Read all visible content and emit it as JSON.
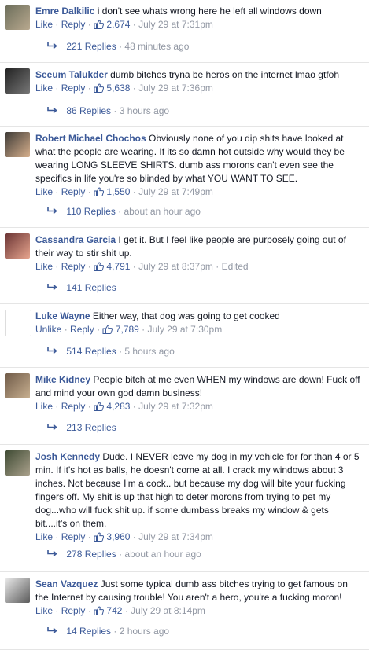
{
  "colors": {
    "link": "#3b5998",
    "meta": "#9197a3",
    "text": "#141823",
    "divider": "#e5e5e5"
  },
  "comments": [
    {
      "author": "Emre Dalkilic",
      "text": "i don't see whats wrong here he left all windows down",
      "like_label": "Like",
      "reply_label": "Reply",
      "likes": "2,674",
      "timestamp": "July 29 at 7:31pm",
      "edited": "",
      "replies": "221 Replies",
      "replies_time": "48 minutes ago",
      "avatar_icon": "profile-photo"
    },
    {
      "author": "Seeum Talukder",
      "text": "dumb bitches tryna be heros on the internet lmao gtfoh",
      "like_label": "Like",
      "reply_label": "Reply",
      "likes": "5,638",
      "timestamp": "July 29 at 7:36pm",
      "edited": "",
      "replies": "86 Replies",
      "replies_time": "3 hours ago",
      "avatar_icon": "profile-photo"
    },
    {
      "author": "Robert Michael Chochos",
      "text": "Obviously none of you dip shits have looked at what the people are wearing. If its so damn hot outside why would they be wearing LONG SLEEVE SHIRTS. dumb ass morons can't even see the specifics in life you're so blinded by what YOU WANT TO SEE.",
      "like_label": "Like",
      "reply_label": "Reply",
      "likes": "1,550",
      "timestamp": "July 29 at 7:49pm",
      "edited": "",
      "replies": "110 Replies",
      "replies_time": "about an hour ago",
      "avatar_icon": "profile-photo"
    },
    {
      "author": "Cassandra Garcia",
      "text": "I get it. But I feel like people are purposely going out of their way to stir shit up.",
      "like_label": "Like",
      "reply_label": "Reply",
      "likes": "4,791",
      "timestamp": "July 29 at 8:37pm",
      "edited": "Edited",
      "replies": "141 Replies",
      "replies_time": "",
      "avatar_icon": "profile-photo"
    },
    {
      "author": "Luke Wayne",
      "text": "Either way, that dog was going to get cooked",
      "like_label": "Unlike",
      "reply_label": "Reply",
      "likes": "7,789",
      "timestamp": "July 29 at 7:30pm",
      "edited": "",
      "replies": "514 Replies",
      "replies_time": "5 hours ago",
      "avatar_icon": "profile-photo"
    },
    {
      "author": "Mike Kidney",
      "text": "People bitch at me even WHEN my windows are down! Fuck off and mind your own god damn business!",
      "like_label": "Like",
      "reply_label": "Reply",
      "likes": "4,283",
      "timestamp": "July 29 at 7:32pm",
      "edited": "",
      "replies": "213 Replies",
      "replies_time": "",
      "avatar_icon": "profile-photo"
    },
    {
      "author": "Josh Kennedy",
      "text": "Dude. I NEVER leave my dog in my vehicle for for than 4 or 5 min. If it's hot as balls, he doesn't come at all. I crack my windows about 3 inches. Not because I'm a cock.. but because my dog will bite your fucking fingers off. My shit is up that high to deter morons from trying to pet my dog...who will fuck shit up. if some dumbass breaks my window & gets bit....it's on them.",
      "like_label": "Like",
      "reply_label": "Reply",
      "likes": "3,960",
      "timestamp": "July 29 at 7:34pm",
      "edited": "",
      "replies": "278 Replies",
      "replies_time": "about an hour ago",
      "avatar_icon": "profile-photo"
    },
    {
      "author": "Sean Vazquez",
      "text": "Just some typical dumb ass bitches trying to get famous on the Internet by causing trouble! You aren't a hero, you're a fucking moron!",
      "like_label": "Like",
      "reply_label": "Reply",
      "likes": "742",
      "timestamp": "July 29 at 8:14pm",
      "edited": "",
      "replies": "14 Replies",
      "replies_time": "2 hours ago",
      "avatar_icon": "profile-photo"
    }
  ]
}
